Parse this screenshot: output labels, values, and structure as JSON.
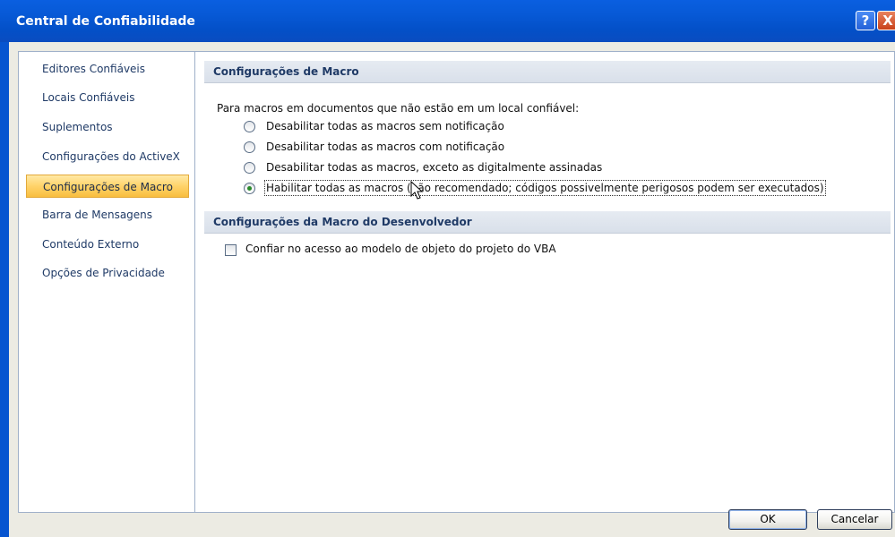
{
  "window": {
    "title": "Central de Confiabilidade",
    "help_glyph": "?",
    "close_glyph": "X"
  },
  "sidebar": {
    "items": [
      {
        "label": "Editores Confiáveis",
        "active": false
      },
      {
        "label": "Locais Confiáveis",
        "active": false
      },
      {
        "label": "Suplementos",
        "active": false
      },
      {
        "label": "Configurações do ActiveX",
        "active": false
      },
      {
        "label": "Configurações de Macro",
        "active": true
      },
      {
        "label": "Barra de Mensagens",
        "active": false
      },
      {
        "label": "Conteúdo Externo",
        "active": false
      },
      {
        "label": "Opções de Privacidade",
        "active": false
      }
    ]
  },
  "macro_settings": {
    "header": "Configurações de Macro",
    "intro": "Para macros em documentos que não estão em um local confiável:",
    "options": [
      {
        "label": "Desabilitar todas as macros sem notificação",
        "checked": false
      },
      {
        "label": "Desabilitar todas as macros com notificação",
        "checked": false
      },
      {
        "label": "Desabilitar todas as macros, exceto as digitalmente assinadas",
        "checked": false
      },
      {
        "label": "Habilitar todas as macros (não recomendado; códigos possivelmente perigosos podem ser executados)",
        "checked": true
      }
    ]
  },
  "developer_settings": {
    "header": "Configurações da Macro do Desenvolvedor",
    "vba_checkbox": {
      "label": "Confiar no acesso ao modelo de objeto do projeto do VBA",
      "checked": false
    }
  },
  "buttons": {
    "ok": "OK",
    "cancel": "Cancelar"
  },
  "colors": {
    "titlebar": "#0759d6",
    "active_item": "#ffd36a",
    "dialog_background": "#ecebe3",
    "selected_radio_dot": "#2a8a2a"
  }
}
